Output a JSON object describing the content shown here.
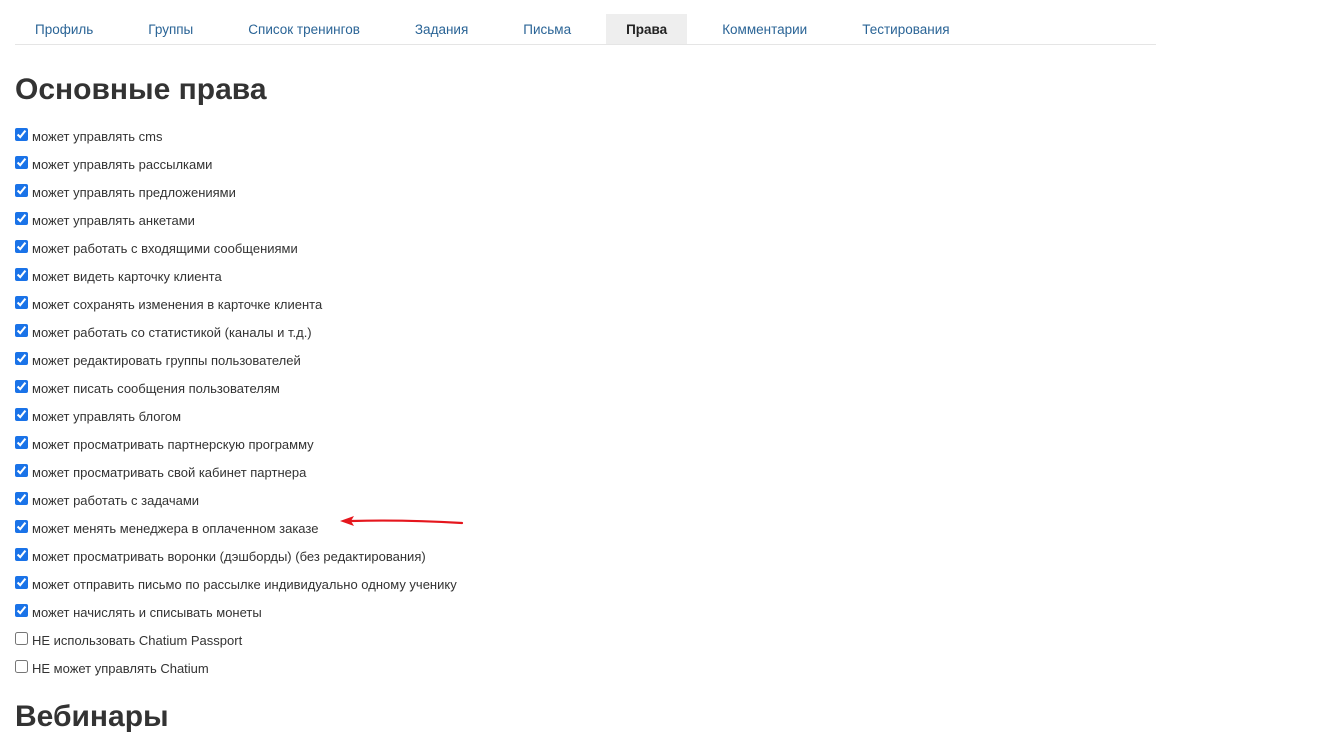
{
  "tabs": [
    {
      "label": "Профиль",
      "active": false
    },
    {
      "label": "Группы",
      "active": false
    },
    {
      "label": "Список тренингов",
      "active": false
    },
    {
      "label": "Задания",
      "active": false
    },
    {
      "label": "Письма",
      "active": false
    },
    {
      "label": "Права",
      "active": true
    },
    {
      "label": "Комментарии",
      "active": false
    },
    {
      "label": "Тестирования",
      "active": false
    }
  ],
  "main_section": {
    "title": "Основные права",
    "permissions": [
      {
        "label": "может управлять cms",
        "checked": true
      },
      {
        "label": "может управлять рассылками",
        "checked": true
      },
      {
        "label": "может управлять предложениями",
        "checked": true
      },
      {
        "label": "может управлять анкетами",
        "checked": true
      },
      {
        "label": "может работать с входящими сообщениями",
        "checked": true
      },
      {
        "label": "может видеть карточку клиента",
        "checked": true
      },
      {
        "label": "может сохранять изменения в карточке клиента",
        "checked": true
      },
      {
        "label": "может работать со статистикой (каналы и т.д.)",
        "checked": true
      },
      {
        "label": "может редактировать группы пользователей",
        "checked": true
      },
      {
        "label": "может писать сообщения пользователям",
        "checked": true
      },
      {
        "label": "может управлять блогом",
        "checked": true
      },
      {
        "label": "может просматривать партнерскую программу",
        "checked": true
      },
      {
        "label": "может просматривать свой кабинет партнера",
        "checked": true
      },
      {
        "label": "может работать с задачами",
        "checked": true
      },
      {
        "label": "может менять менеджера в оплаченном заказе",
        "checked": true
      },
      {
        "label": "может просматривать воронки (дэшборды) (без редактирования)",
        "checked": true
      },
      {
        "label": "может отправить письмо по рассылке индивидуально одному ученику",
        "checked": true
      },
      {
        "label": "может начислять и списывать монеты",
        "checked": true
      },
      {
        "label": "НЕ использовать Chatium Passport",
        "checked": false
      },
      {
        "label": "НЕ может управлять Chatium",
        "checked": false
      }
    ]
  },
  "webinar_section": {
    "title": "Вебинары"
  },
  "annotation": {
    "arrow_color": "#e5161d"
  }
}
